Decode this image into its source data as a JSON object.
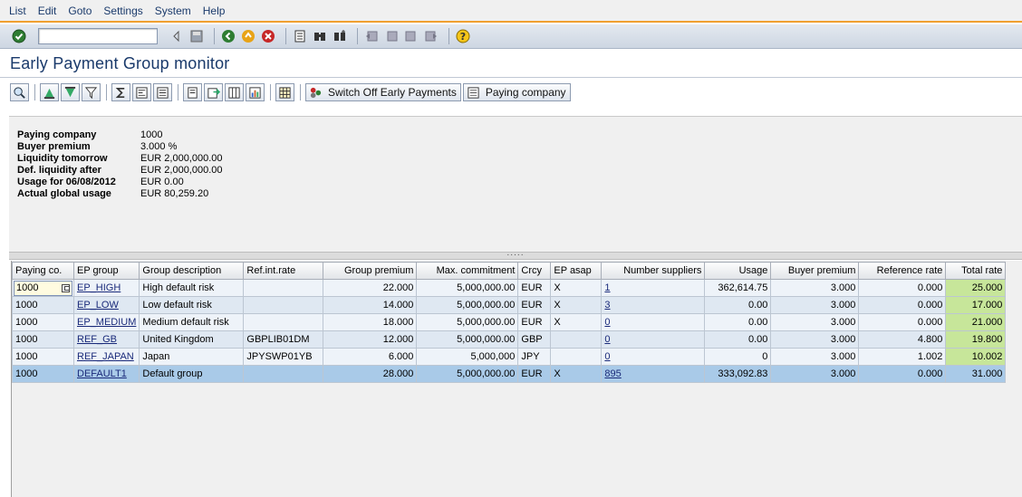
{
  "menu": [
    "List",
    "Edit",
    "Goto",
    "Settings",
    "System",
    "Help"
  ],
  "title": "Early Payment Group monitor",
  "app_toolbar": {
    "switch_off_label": "Switch Off Early Payments",
    "paying_company_label": "Paying company"
  },
  "header_info": [
    {
      "label": "Paying company",
      "value": "1000"
    },
    {
      "label": "Buyer premium",
      "value": "3.000 %"
    },
    {
      "label": "Liquidity tomorrow",
      "value": "EUR 2,000,000.00"
    },
    {
      "label": "Def. liquidity after",
      "value": "EUR 2,000,000.00"
    },
    {
      "label": "Usage for 06/08/2012",
      "value": "EUR 0.00"
    },
    {
      "label": "Actual global usage",
      "value": "EUR 80,259.20"
    }
  ],
  "grid": {
    "columns": [
      "Paying co.",
      "EP group",
      "Group description",
      "Ref.int.rate",
      "Group premium",
      "Max. commitment",
      "Crcy",
      "EP asap",
      "Number suppliers",
      "Usage",
      "Buyer premium",
      "Reference rate",
      "Total rate"
    ],
    "rows": [
      [
        "1000",
        "EP_HIGH",
        "High default risk",
        "",
        "22.000",
        "5,000,000.00",
        "EUR",
        "X",
        "1",
        "362,614.75",
        "3.000",
        "0.000",
        "25.000"
      ],
      [
        "1000",
        "EP_LOW",
        "Low default risk",
        "",
        "14.000",
        "5,000,000.00",
        "EUR",
        "X",
        "3",
        "0.00",
        "3.000",
        "0.000",
        "17.000"
      ],
      [
        "1000",
        "EP_MEDIUM",
        "Medium default risk",
        "",
        "18.000",
        "5,000,000.00",
        "EUR",
        "X",
        "0",
        "0.00",
        "3.000",
        "0.000",
        "21.000"
      ],
      [
        "1000",
        "REF_GB",
        "United Kingdom",
        "GBPLIB01DM",
        "12.000",
        "5,000,000.00",
        "GBP",
        "",
        "0",
        "0.00",
        "3.000",
        "4.800",
        "19.800"
      ],
      [
        "1000",
        "REF_JAPAN",
        "Japan",
        "JPYSWP01YB",
        "6.000",
        "5,000,000",
        "JPY",
        "",
        "0",
        "0",
        "3.000",
        "1.002",
        "10.002"
      ],
      [
        "1000",
        "DEFAULT1",
        "Default group",
        "",
        "28.000",
        "5,000,000.00",
        "EUR",
        "X",
        "895",
        "333,092.83",
        "3.000",
        "0.000",
        "31.000"
      ]
    ]
  },
  "colors": {
    "title": "#1a3a6b",
    "highlight_total": "#c7e69a",
    "selected_row": "#a9cae8",
    "menu_accent": "#f0a030"
  }
}
